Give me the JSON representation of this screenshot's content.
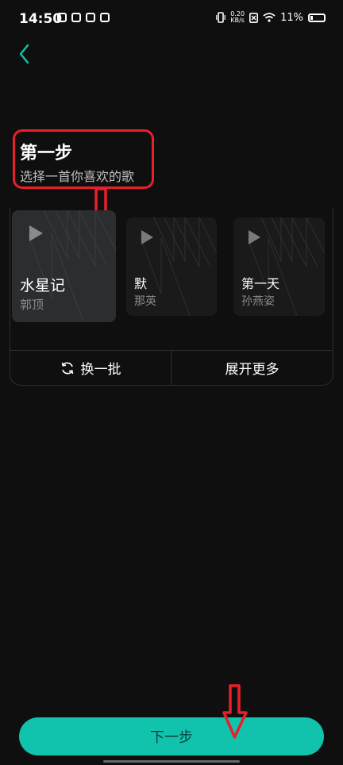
{
  "status_bar": {
    "time": "14:50",
    "net_speed_value": "0.20",
    "net_speed_unit": "KB/s",
    "battery_text": "11%"
  },
  "step": {
    "title": "第一步",
    "subtitle": "选择一首你喜欢的歌"
  },
  "songs": [
    {
      "title": "水星记",
      "artist": "郭顶",
      "selected": true
    },
    {
      "title": "默",
      "artist": "那英",
      "selected": false
    },
    {
      "title": "第一天",
      "artist": "孙燕姿",
      "selected": false
    }
  ],
  "actions": {
    "refresh_label": "换一批",
    "more_label": "展开更多"
  },
  "next_label": "下一步",
  "colors": {
    "accent": "#11c3ad",
    "annotation": "#e8202a",
    "background": "#0f0f0f"
  }
}
